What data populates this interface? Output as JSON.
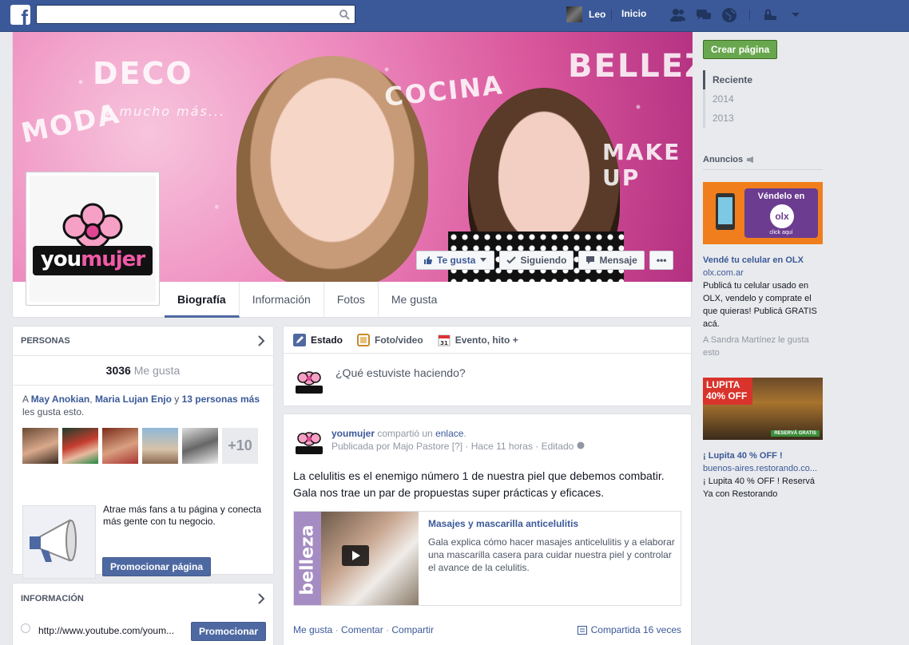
{
  "topbar": {
    "search_placeholder": "",
    "user_name": "Leo",
    "home_label": "Inicio"
  },
  "cover": {
    "words": [
      "DECO",
      "MODA",
      "y mucho más...",
      "COCINA",
      "BELLEZA",
      "MAKE UP"
    ],
    "like_button": "Te gusta",
    "following_button": "Siguiendo",
    "message_button": "Mensaje",
    "more_button": "•••",
    "logo_text_a": "you",
    "logo_text_b": "mujer"
  },
  "tabs": [
    "Biografía",
    "Información",
    "Fotos",
    "Me gusta"
  ],
  "people": {
    "header": "PERSONAS",
    "likes_count": "3036",
    "likes_label": "Me gusta",
    "friends_prefix": "A ",
    "friend1": "May Anokian",
    "sep": ", ",
    "friend2": "Maria Lujan Enjo",
    "mid": " y ",
    "more_people": "13 personas más",
    "suffix": " les gusta esto.",
    "plus_count": "+10",
    "promo_text": "Atrae más fans a tu página y conecta más gente con tu negocio.",
    "promo_button": "Promocionar página"
  },
  "info": {
    "header": "INFORMACIÓN",
    "url": "http://www.youtube.com/youm...",
    "promote_button": "Promocionar"
  },
  "composer": {
    "tab_status": "Estado",
    "tab_photo": "Foto/video",
    "tab_event": "Evento, hito +",
    "placeholder": "¿Qué estuviste haciendo?"
  },
  "post": {
    "author": "youmujer",
    "shared": " compartió un ",
    "link_word": "enlace",
    "dot": ".",
    "published_by": "Publicada por Majo Pastore",
    "q": " [?] · ",
    "time": "Hace 11 horas",
    "edited": " · Editado",
    "body": "La celulitis es el enemigo número 1 de nuestra piel que debemos combatir. Gala nos trae un par de propuestas super prácticas y eficaces.",
    "attach_title": "Masajes y mascarilla anticelulitis",
    "attach_desc": "Gala explica cómo hacer masajes anticelulitis y a elaborar una mascarilla casera para cuidar nuestra piel y controlar el avance de la celulitis.",
    "attach_side": "belleza",
    "action_like": "Me gusta",
    "action_comment": "Comentar",
    "action_share": "Compartir",
    "shared_count": "Compartida 16 veces"
  },
  "right": {
    "create_page": "Crear página",
    "years": [
      "Reciente",
      "2014",
      "2013"
    ],
    "ads_label": "Anuncios",
    "ad1": {
      "img_line1": "Véndelo en",
      "img_line2": "click aquí",
      "img_brand": "olx",
      "title": "Vendé tu celular en OLX",
      "url": "olx.com.ar",
      "body": "Publicá tu celular usado en OLX, vendelo y comprate el que quieras! Publicá GRATIS acá.",
      "social": "A Sandra Martínez le gusta esto"
    },
    "ad2": {
      "img_line1": "LUPITA",
      "img_line2": "40% OFF",
      "img_tag": "RESERVÁ GRATIS",
      "title": "¡ Lupita 40 % OFF !",
      "url": "buenos-aires.restorando.co...",
      "body": "¡ Lupita 40 % OFF ! Reservá Ya con Restorando"
    }
  },
  "colors": {
    "fb_blue": "#3b5998",
    "accent_green": "#69a74e",
    "background": "#e9eaed"
  }
}
